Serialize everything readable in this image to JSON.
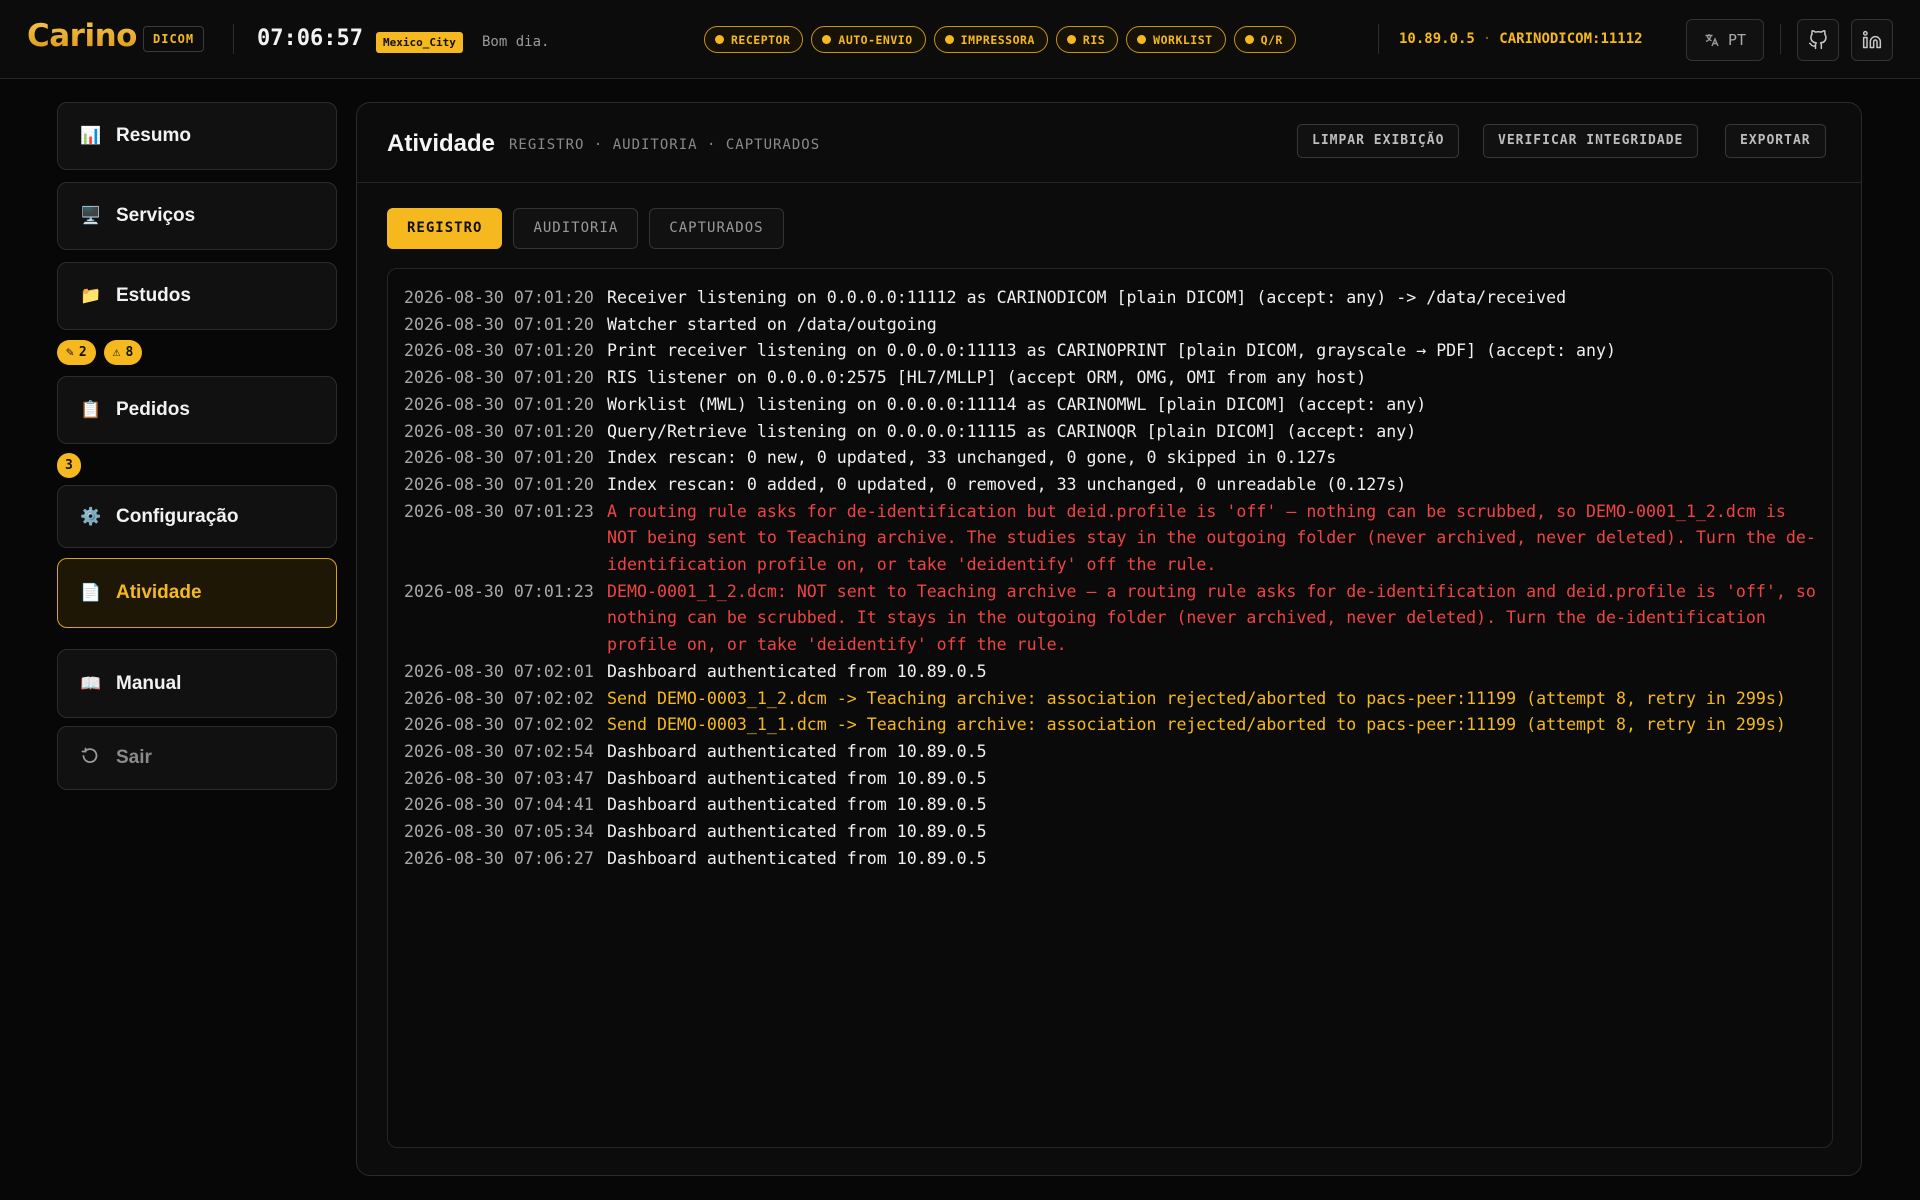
{
  "header": {
    "logo": "Carino",
    "product_badge": "DICOM",
    "clock": "07:06:57",
    "timezone": "Mexico_City",
    "greeting": "Bom dia.",
    "status_pills": [
      "RECEPTOR",
      "AUTO-ENVIO",
      "IMPRESSORA",
      "RIS",
      "WORKLIST",
      "Q/R"
    ],
    "ip": "10.89.0.5",
    "ae_title": "CARINODICOM:11112",
    "language": "PT",
    "icons": [
      "translate-icon",
      "github-icon",
      "linkedin-icon"
    ],
    "accent_color": "#f5b91f"
  },
  "sidebar": {
    "items": [
      {
        "label": "Resumo",
        "icon": "chart-icon"
      },
      {
        "label": "Serviços",
        "icon": "monitor-icon"
      },
      {
        "label": "Estudos",
        "icon": "folder-icon"
      },
      {
        "label": "Pedidos",
        "icon": "clipboard-icon"
      },
      {
        "label": "Configuração",
        "icon": "gear-icon"
      },
      {
        "label": "Atividade",
        "icon": "document-icon",
        "active": true
      },
      {
        "label": "Manual",
        "icon": "book-icon"
      },
      {
        "label": "Sair",
        "icon": "logout-icon"
      }
    ],
    "estudos_counters": [
      {
        "icon": "✎",
        "value": "2"
      },
      {
        "icon": "⚠",
        "value": "8"
      }
    ],
    "pedidos_counter": "3"
  },
  "main": {
    "title": "Atividade",
    "subtitle": "REGISTRO · AUDITORIA · CAPTURADOS",
    "actions": [
      "LIMPAR EXIBIÇÃO",
      "VERIFICAR INTEGRIDADE",
      "EXPORTAR"
    ],
    "tabs": [
      {
        "label": "REGISTRO",
        "active": true
      },
      {
        "label": "AUDITORIA",
        "active": false
      },
      {
        "label": "CAPTURADOS",
        "active": false
      }
    ],
    "log": [
      {
        "ts": "2026-08-30 07:01:20",
        "level": "info",
        "msg": "Receiver listening on 0.0.0.0:11112 as CARINODICOM [plain DICOM] (accept: any) -> /data/received"
      },
      {
        "ts": "2026-08-30 07:01:20",
        "level": "info",
        "msg": "Watcher started on /data/outgoing"
      },
      {
        "ts": "2026-08-30 07:01:20",
        "level": "info",
        "msg": "Print receiver listening on 0.0.0.0:11113 as CARINOPRINT [plain DICOM, grayscale → PDF] (accept: any)"
      },
      {
        "ts": "2026-08-30 07:01:20",
        "level": "info",
        "msg": "RIS listener on 0.0.0.0:2575 [HL7/MLLP] (accept ORM, OMG, OMI from any host)"
      },
      {
        "ts": "2026-08-30 07:01:20",
        "level": "info",
        "msg": "Worklist (MWL) listening on 0.0.0.0:11114 as CARINOMWL [plain DICOM] (accept: any)"
      },
      {
        "ts": "2026-08-30 07:01:20",
        "level": "info",
        "msg": "Query/Retrieve listening on 0.0.0.0:11115 as CARINOQR [plain DICOM] (accept: any)"
      },
      {
        "ts": "2026-08-30 07:01:20",
        "level": "info",
        "msg": "Index rescan: 0 new, 0 updated, 33 unchanged, 0 gone, 0 skipped in 0.127s"
      },
      {
        "ts": "2026-08-30 07:01:20",
        "level": "info",
        "msg": "Index rescan: 0 added, 0 updated, 0 removed, 33 unchanged, 0 unreadable (0.127s)"
      },
      {
        "ts": "2026-08-30 07:01:23",
        "level": "error",
        "msg": "A routing rule asks for de-identification but deid.profile is 'off' — nothing can be scrubbed, so DEMO-0001_1_2.dcm is NOT being sent to Teaching archive. The studies stay in the outgoing folder (never archived, never deleted). Turn the de-identification profile on, or take 'deidentify' off the rule."
      },
      {
        "ts": "2026-08-30 07:01:23",
        "level": "error",
        "msg": "DEMO-0001_1_2.dcm: NOT sent to Teaching archive — a routing rule asks for de-identification and deid.profile is 'off', so nothing can be scrubbed. It stays in the outgoing folder (never archived, never deleted). Turn the de-identification profile on, or take 'deidentify' off the rule."
      },
      {
        "ts": "2026-08-30 07:02:01",
        "level": "info",
        "msg": "Dashboard authenticated from 10.89.0.5"
      },
      {
        "ts": "2026-08-30 07:02:02",
        "level": "warn",
        "msg": "Send DEMO-0003_1_2.dcm -> Teaching archive: association rejected/aborted to pacs-peer:11199 (attempt 8, retry in 299s)"
      },
      {
        "ts": "2026-08-30 07:02:02",
        "level": "warn",
        "msg": "Send DEMO-0003_1_1.dcm -> Teaching archive: association rejected/aborted to pacs-peer:11199 (attempt 8, retry in 299s)"
      },
      {
        "ts": "2026-08-30 07:02:54",
        "level": "info",
        "msg": "Dashboard authenticated from 10.89.0.5"
      },
      {
        "ts": "2026-08-30 07:03:47",
        "level": "info",
        "msg": "Dashboard authenticated from 10.89.0.5"
      },
      {
        "ts": "2026-08-30 07:04:41",
        "level": "info",
        "msg": "Dashboard authenticated from 10.89.0.5"
      },
      {
        "ts": "2026-08-30 07:05:34",
        "level": "info",
        "msg": "Dashboard authenticated from 10.89.0.5"
      },
      {
        "ts": "2026-08-30 07:06:27",
        "level": "info",
        "msg": "Dashboard authenticated from 10.89.0.5"
      }
    ]
  }
}
